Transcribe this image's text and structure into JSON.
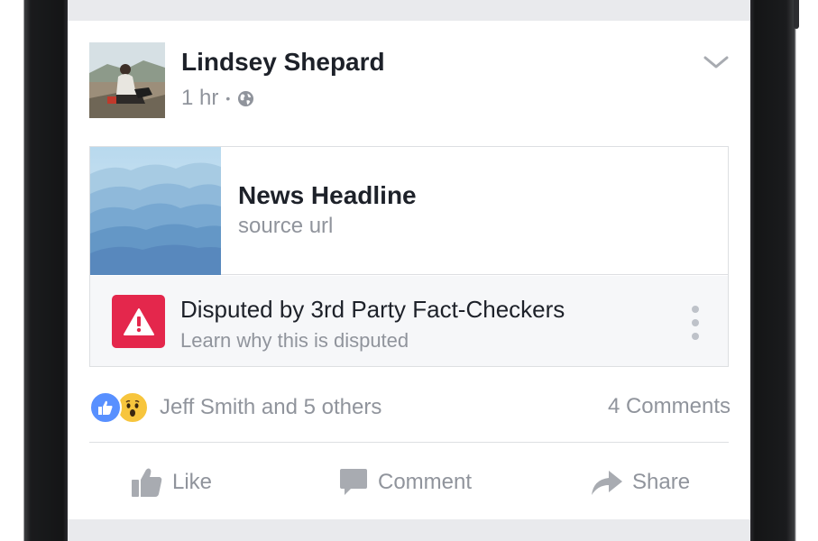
{
  "post": {
    "author": "Lindsey Shepard",
    "time": "1 hr",
    "separator": "•",
    "privacy_icon": "globe-icon",
    "menu_icon": "chevron-down-icon"
  },
  "link": {
    "headline": "News Headline",
    "source": "source url"
  },
  "dispute": {
    "title": "Disputed by 3rd Party Fact-Checkers",
    "subtitle": "Learn why this is disputed",
    "icon": "warning-icon",
    "menu_icon": "more-vertical-icon"
  },
  "engagement": {
    "reactions_text": "Jeff Smith and 5 others",
    "comments_text": "4 Comments",
    "reaction_icons": [
      "like-reaction-icon",
      "wow-reaction-icon"
    ]
  },
  "actions": {
    "like_label": "Like",
    "comment_label": "Comment",
    "share_label": "Share"
  },
  "colors": {
    "warning": "#e4274c",
    "like_blue": "#5890ff",
    "wow_yellow": "#f7c53d",
    "text_primary": "#1d2129",
    "text_secondary": "#90949c",
    "background": "#e9eaed"
  }
}
